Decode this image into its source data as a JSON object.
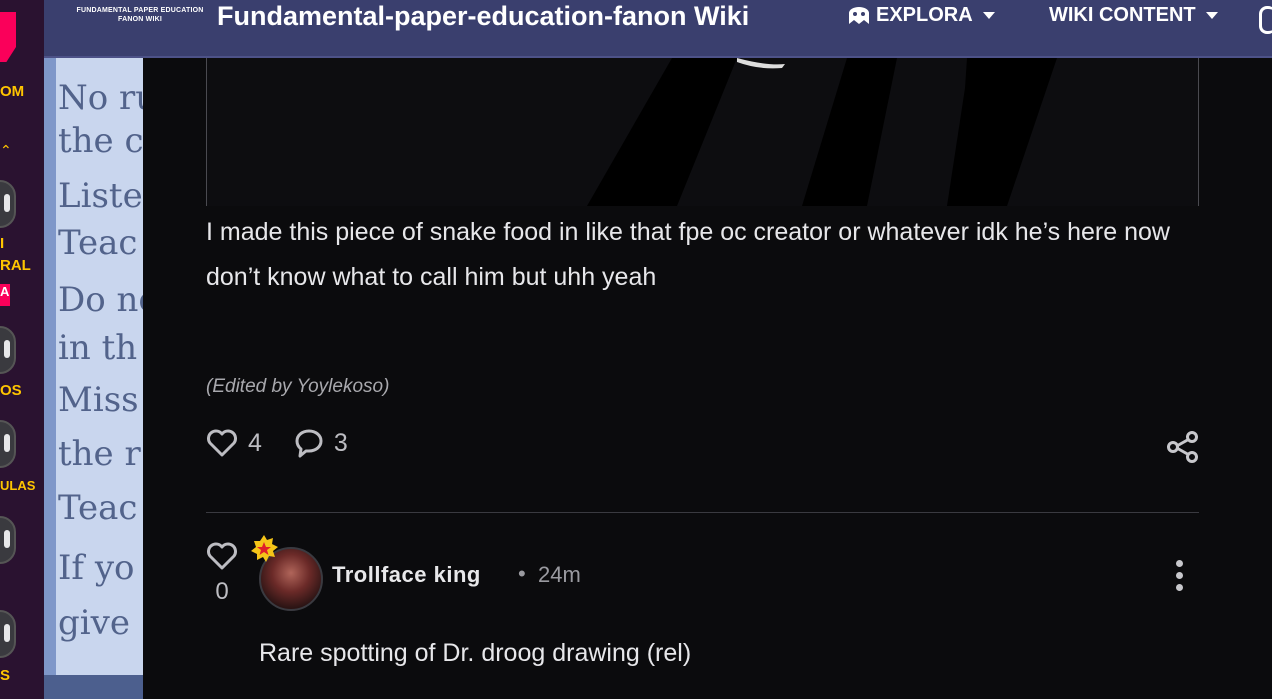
{
  "rail": {
    "labels": [
      "OM",
      "I",
      "RAL",
      "A",
      "OS",
      "ULAS",
      "S"
    ]
  },
  "topbar": {
    "wordmark": "FUNDAMENTAL PAPER EDUCATION FANON WIKI",
    "site_title": "Fundamental-paper-education-fanon Wiki",
    "nav": [
      {
        "label": "EXPLORA",
        "icon": "explore-icon"
      },
      {
        "label": "WIKI CONTENT"
      }
    ]
  },
  "background_board": {
    "lines": [
      "No ru",
      "the cl",
      "Listen",
      "Teac",
      "Do no",
      "in th",
      "Miss",
      "the r",
      "Teac",
      "If yo",
      "give"
    ]
  },
  "post": {
    "body": "I made this piece of snake food in like that fpe oc creator or whatever idk he’s here now don’t know what to call him but uhh yeah",
    "edited": "(Edited by Yoylekoso)",
    "likes": "4",
    "comments": "3"
  },
  "reply": {
    "likes": "0",
    "username": "Trollface king",
    "separator": "•",
    "time": "24m",
    "text": "Rare spotting of Dr. droog drawing (rel)"
  },
  "colors": {
    "topbar": "#3a3f6e",
    "rail": "#2a1230",
    "accent": "#fa005a",
    "rail_text": "#ffc500",
    "background": "#0b0b0d"
  }
}
